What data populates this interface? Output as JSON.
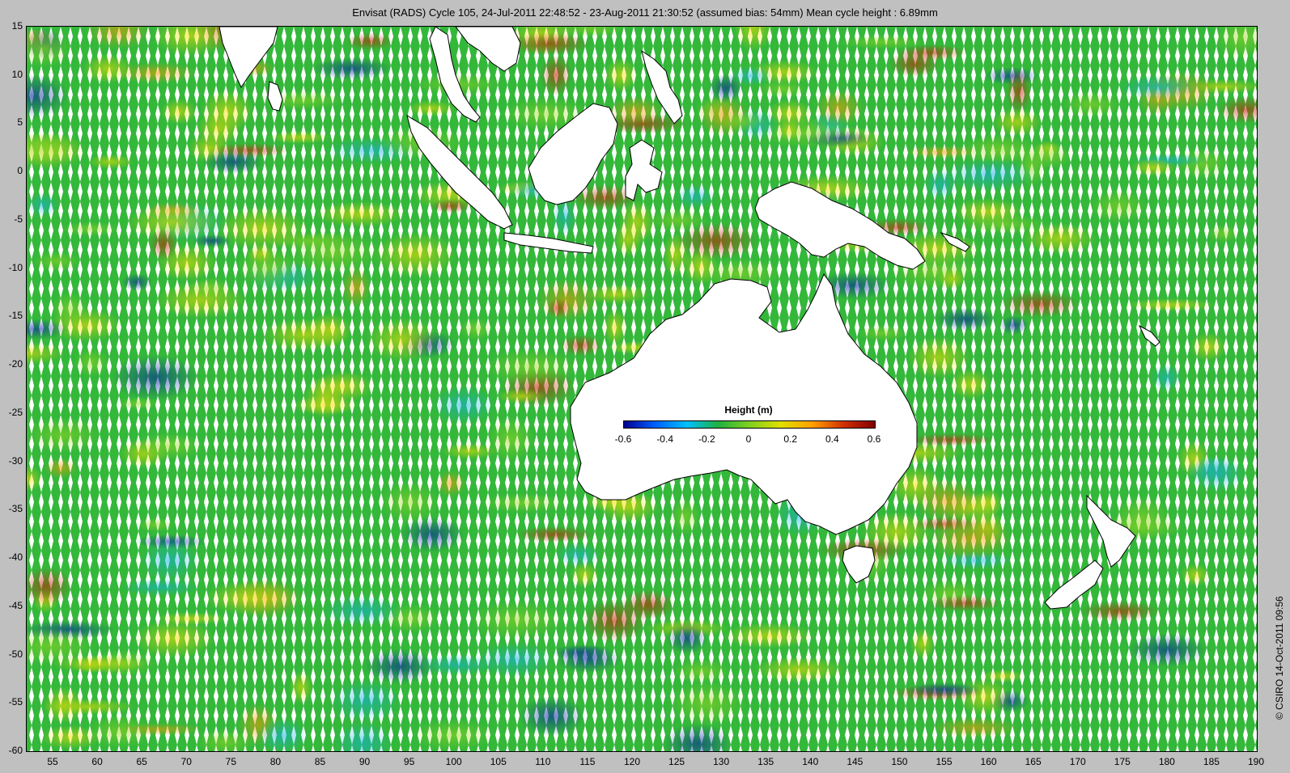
{
  "title": "Envisat (RADS) Cycle 105, 24-Jul-2011 22:48:52 - 23-Aug-2011 21:30:52 (assumed bias: 54mm)  Mean cycle height : 6.89mm",
  "credit": "© CSIRO 14-Oct-2011 09:56",
  "map": {
    "lon_range": [
      52,
      190
    ],
    "lat_range": [
      -60,
      15
    ],
    "y_ticks": [
      "15",
      "10",
      "5",
      "0",
      "-5",
      "-10",
      "-15",
      "-20",
      "-25",
      "-30",
      "-35",
      "-40",
      "-45",
      "-50",
      "-55",
      "-60"
    ],
    "x_ticks": [
      "55",
      "60",
      "65",
      "70",
      "75",
      "80",
      "85",
      "90",
      "95",
      "100",
      "105",
      "110",
      "115",
      "120",
      "125",
      "130",
      "135",
      "140",
      "145",
      "150",
      "155",
      "160",
      "165",
      "170",
      "175",
      "180",
      "185",
      "190"
    ],
    "land_color": "#ffffff",
    "ocean_track_colors": [
      "#1aaa2e",
      "#3cc03c",
      "#8fd42a",
      "#d8e40a",
      "#f7e000",
      "#f5a000"
    ],
    "features": [
      "Australia",
      "New Guinea",
      "Borneo",
      "Sumatra",
      "India",
      "Sri Lanka",
      "Tasmania",
      "New Zealand"
    ]
  },
  "colorbar": {
    "title": "Height (m)",
    "ticks": [
      "-0.6",
      "-0.4",
      "-0.2",
      "0",
      "0.2",
      "0.4",
      "0.6"
    ],
    "colors": [
      "#00008f",
      "#0060ff",
      "#00c0ff",
      "#20b040",
      "#80d020",
      "#e0e000",
      "#ffa000",
      "#d03000",
      "#800000"
    ]
  }
}
